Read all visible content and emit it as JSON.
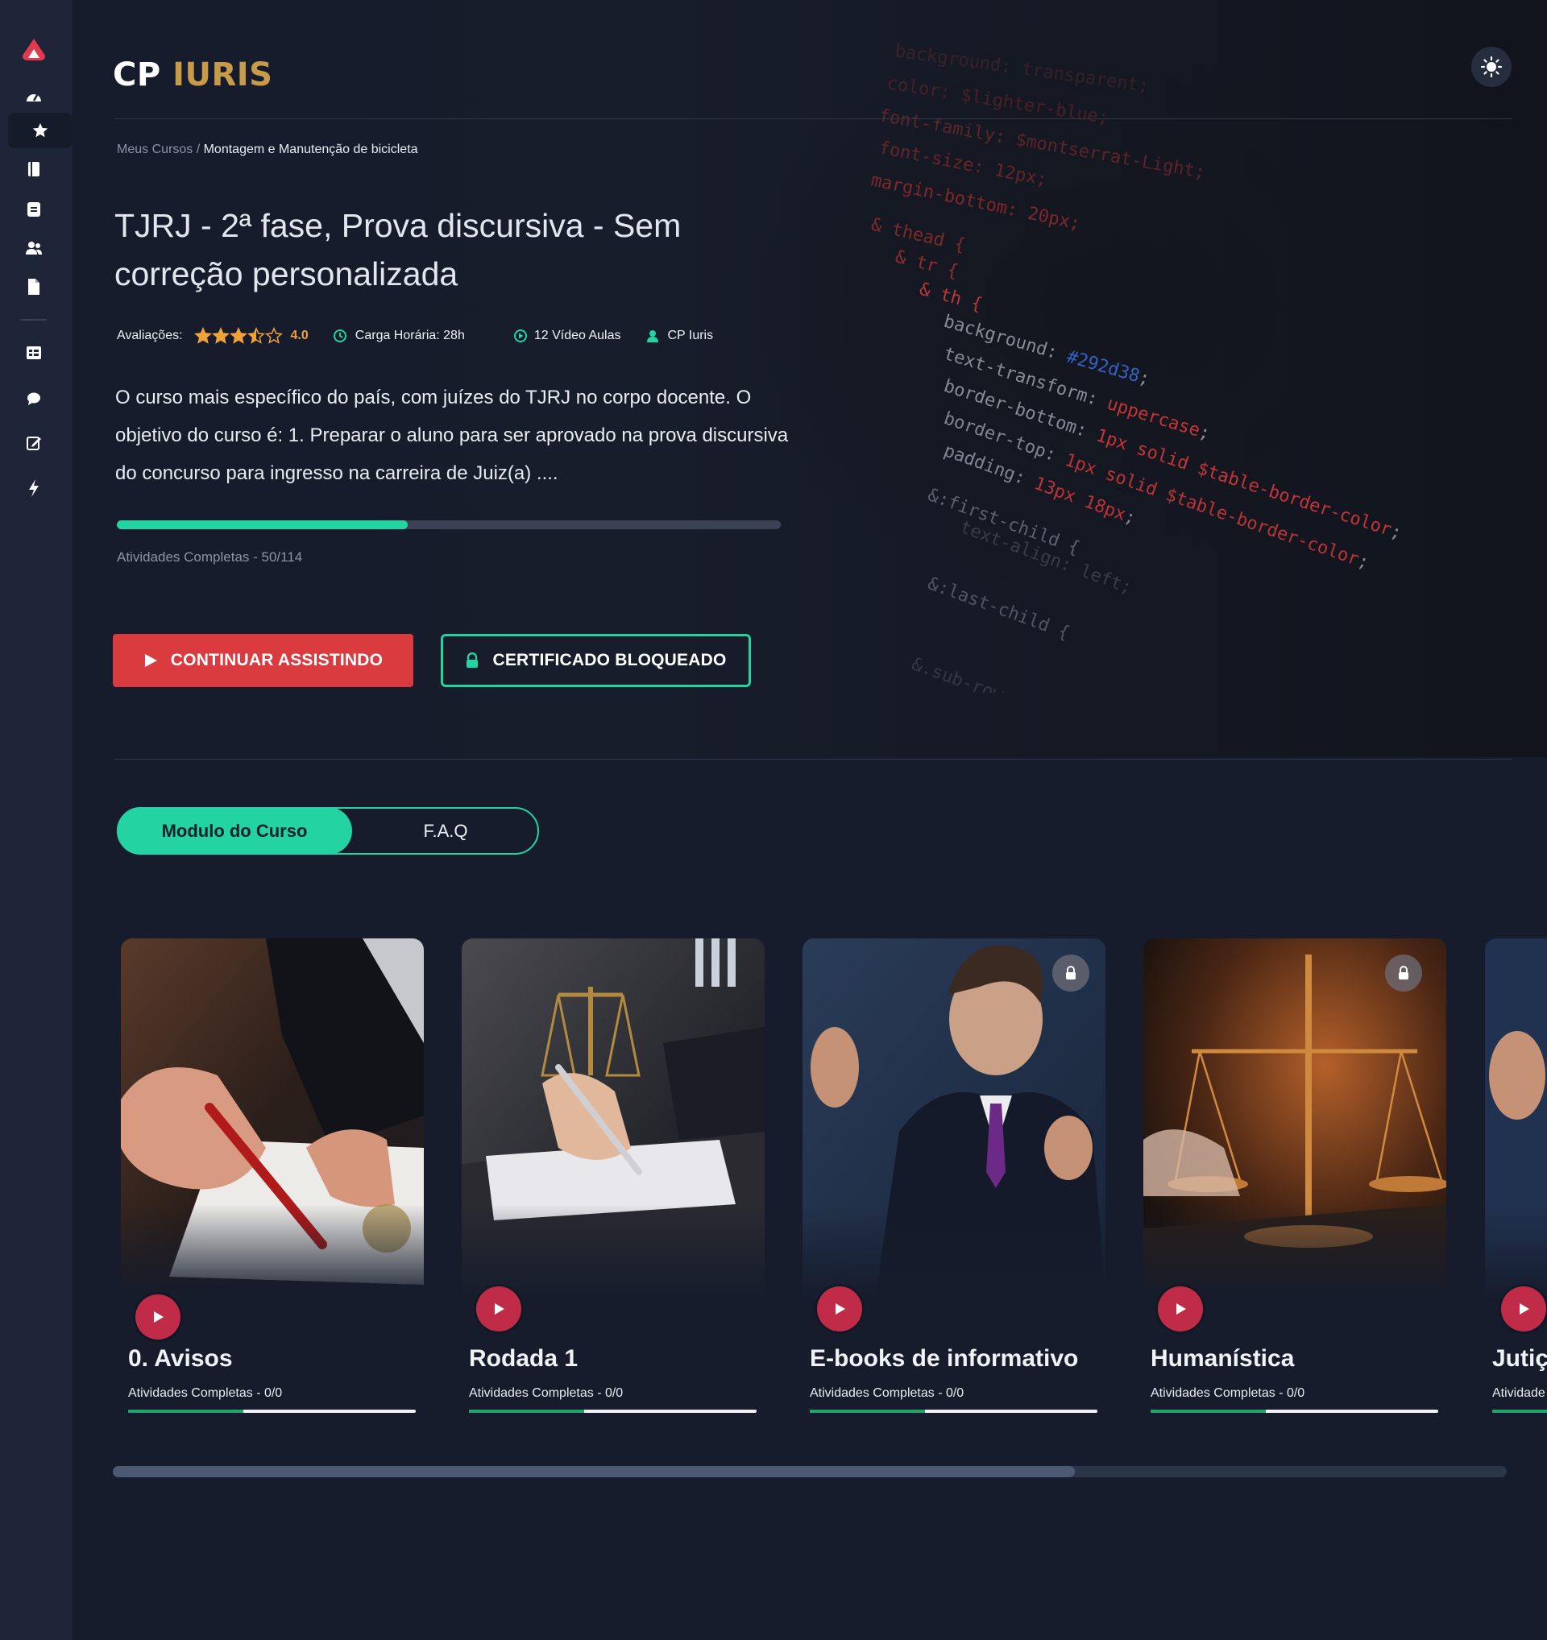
{
  "app": {
    "logo_part1": "CP",
    "logo_part2": "IURIS"
  },
  "sidebar": {
    "items": [
      {
        "name": "logo-icon",
        "active": false
      },
      {
        "name": "dashboard-icon",
        "active": false
      },
      {
        "name": "star-icon",
        "active": true
      },
      {
        "name": "book-icon",
        "active": false
      },
      {
        "name": "notes-icon",
        "active": false
      },
      {
        "name": "users-icon",
        "active": false
      },
      {
        "name": "document-icon",
        "active": false
      },
      {
        "name": "table-icon",
        "active": false
      },
      {
        "name": "chat-icon",
        "active": false
      },
      {
        "name": "edit-icon",
        "active": false
      },
      {
        "name": "lightning-icon",
        "active": false
      }
    ]
  },
  "header": {
    "theme_toggle_icon": "sun-icon"
  },
  "breadcrumb": {
    "parent": "Meus Cursos",
    "separator": " / ",
    "current": "Montagem e Manutenção de bicicleta"
  },
  "course": {
    "title": "TJRJ - 2ª fase, Prova discursiva - Sem correção personalizada",
    "rating_label": "Avaliações:",
    "rating_value": "4.0",
    "rating": 3.5,
    "rating_max": 5,
    "workload": "Carga Horária: 28h",
    "video_count": "12 Vídeo Aulas",
    "author": "CP Iuris",
    "description": "O curso mais específico do país, com juízes do TJRJ no corpo docente. O objetivo do curso é: 1. Preparar o aluno para ser aprovado na prova discursiva do concurso para ingresso na carreira de Juiz(a) ....",
    "progress_label": "Atividades Completas - 50/114",
    "progress_done": 50,
    "progress_total": 114
  },
  "actions": {
    "continue_label": "CONTINUAR ASSISTINDO",
    "certificate_label": "CERTIFICADO BLOQUEADO"
  },
  "tabs": [
    {
      "label": "Modulo do Curso",
      "active": true
    },
    {
      "label": "F.A.Q",
      "active": false
    }
  ],
  "modules": [
    {
      "title": "0. Avisos",
      "progress_label": "Atividades Completas - 0/0",
      "locked": false,
      "bar_fill": 0.4
    },
    {
      "title": "Rodada 1",
      "progress_label": "Atividades Completas - 0/0",
      "locked": false,
      "bar_fill": 0.4
    },
    {
      "title": "E-books de informativo",
      "progress_label": "Atividades Completas - 0/0",
      "locked": true,
      "bar_fill": 0.4
    },
    {
      "title": "Humanística",
      "progress_label": "Atividades Completas - 0/0",
      "locked": true,
      "bar_fill": 0.4
    },
    {
      "title": "Jutiç",
      "progress_label": "Atividade",
      "locked": false,
      "bar_fill": 0.4
    }
  ],
  "scroll": {
    "thumb_fraction": 0.69
  },
  "colors": {
    "background": "#161c2c",
    "sidebar": "#1e2538",
    "accent_green": "#23d3a2",
    "accent_red": "#da3b3e",
    "play_red": "#c02c47",
    "logo_gold": "#c89b4b",
    "star_orange": "#f0a23a"
  }
}
